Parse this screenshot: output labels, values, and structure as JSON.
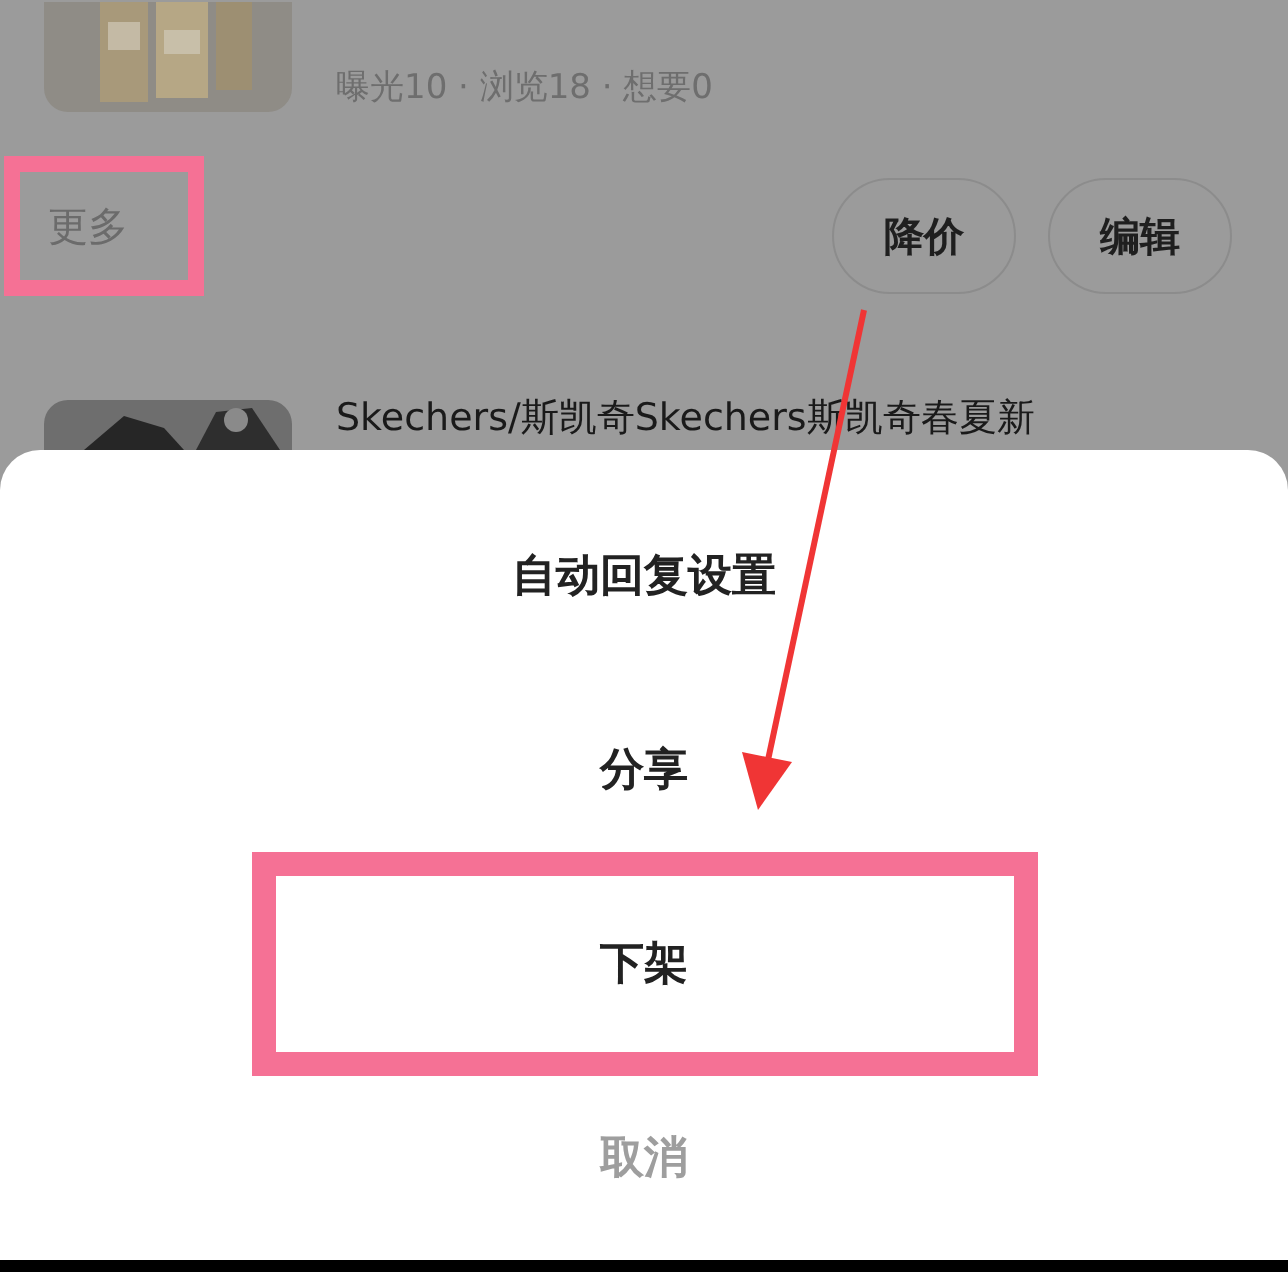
{
  "listing": {
    "stats": "曝光10 · 浏览18 · 想要0",
    "more_link": {
      "label": "更多",
      "highlighted": true
    },
    "buttons": [
      "降价",
      "编辑"
    ]
  },
  "next_listing": {
    "title": "Skechers/斯凯奇Skechers斯凯奇春夏新"
  },
  "action_sheet": {
    "items": [
      {
        "label": "自动回复设置",
        "kind": "action",
        "highlighted": false
      },
      {
        "label": "分享",
        "kind": "action",
        "highlighted": false
      },
      {
        "label": "下架",
        "kind": "action",
        "highlighted": true
      },
      {
        "label": "取消",
        "kind": "cancel",
        "highlighted": false
      }
    ]
  }
}
